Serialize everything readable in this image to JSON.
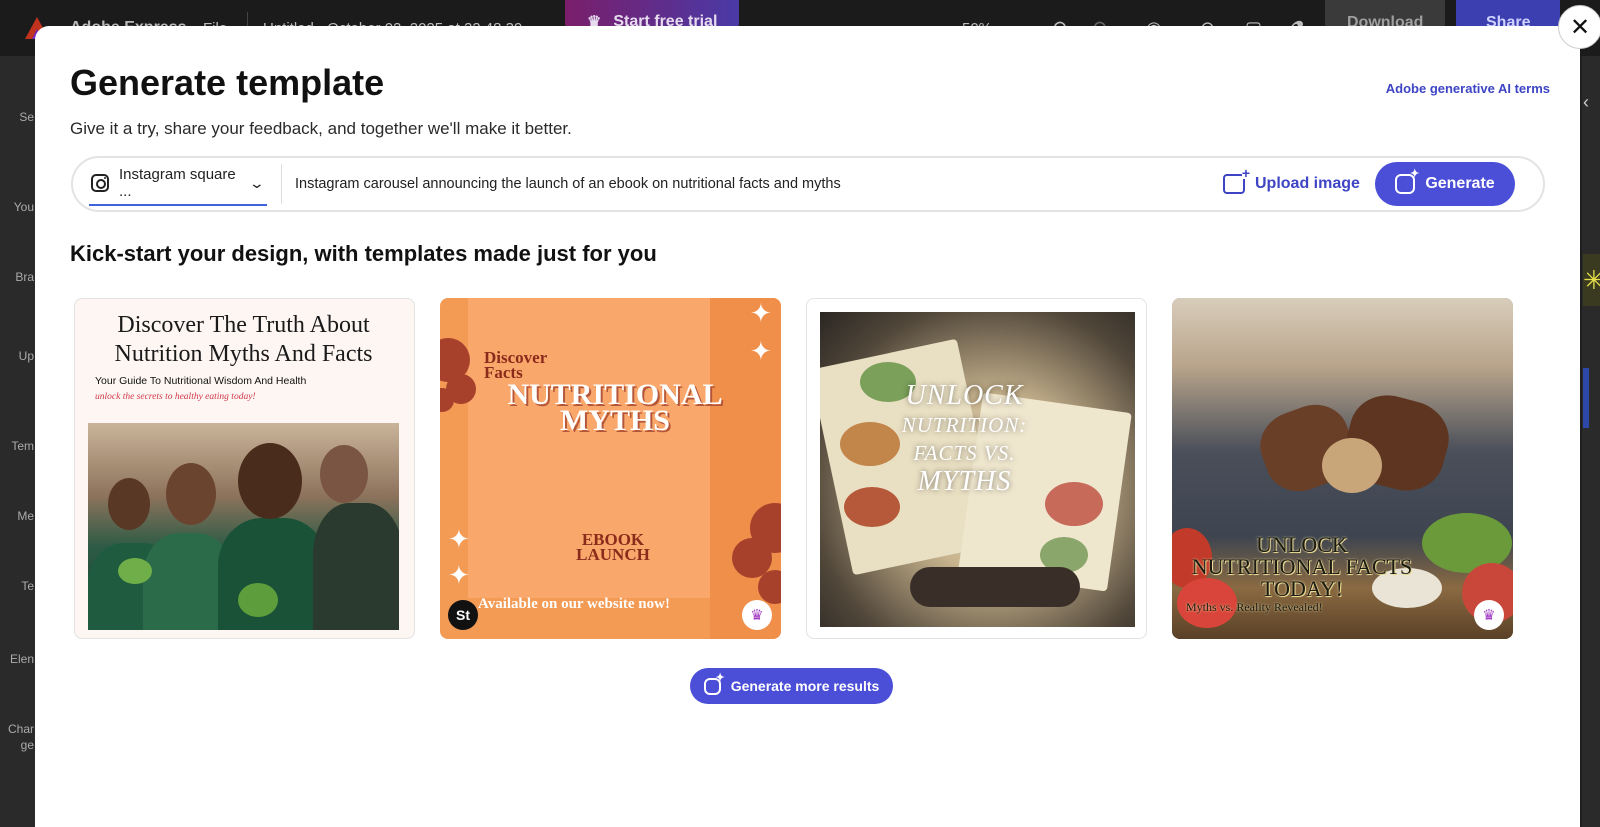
{
  "app": {
    "name": "Adobe Express",
    "file_menu": "File",
    "doc_title": "Untitled - October 02, 2025 at 22.48.39",
    "trial_button": "Start free trial",
    "zoom": "50%",
    "download_button": "Download",
    "share_button": "Share"
  },
  "sidebar": {
    "items": [
      "Se",
      "You",
      "Bra",
      "Up",
      "Tem",
      "Me",
      "Te",
      "Elen",
      "Char",
      "ge"
    ]
  },
  "modal": {
    "title": "Generate template",
    "subtitle": "Give it a try, share your feedback, and together we'll make it better.",
    "terms_link": "Adobe generative AI terms",
    "format_label": "Instagram square ...",
    "prompt": "Instagram carousel announcing the launch of an ebook on nutritional facts and myths",
    "upload_label": "Upload image",
    "generate_label": "Generate",
    "section_title": "Kick-start your design, with templates made just for you",
    "more_label": "Generate more results"
  },
  "templates": [
    {
      "title": "Discover The Truth About Nutrition Myths And Facts",
      "subtitle": "Your Guide To Nutritional Wisdom And Health",
      "tagline": "unlock the secrets to healthy eating today!"
    },
    {
      "kicker": "Discover Facts",
      "headline": "NUTRITIONAL MYTHS",
      "ebook": "EBOOK LAUNCH",
      "footer": "Available on our website now!",
      "badge_left": "St",
      "premium": true
    },
    {
      "line1": "UNLOCK",
      "line2": "NUTRITION:",
      "line3": "FACTS VS.",
      "line4": "MYTHS"
    },
    {
      "headline": "UNLOCK NUTRITIONAL FACTS TODAY!",
      "subtitle": "Myths vs. Reality Revealed!",
      "premium": true
    }
  ],
  "colors": {
    "accent": "#4b4ed6",
    "link": "#3e45c4",
    "premium": "#a43fc4"
  },
  "icons": {
    "close": "close-icon",
    "instagram": "instagram-icon",
    "chevron": "chevron-down-icon",
    "upload": "image-add-icon",
    "generate": "sparkle-icon",
    "crown": "crown-icon"
  }
}
